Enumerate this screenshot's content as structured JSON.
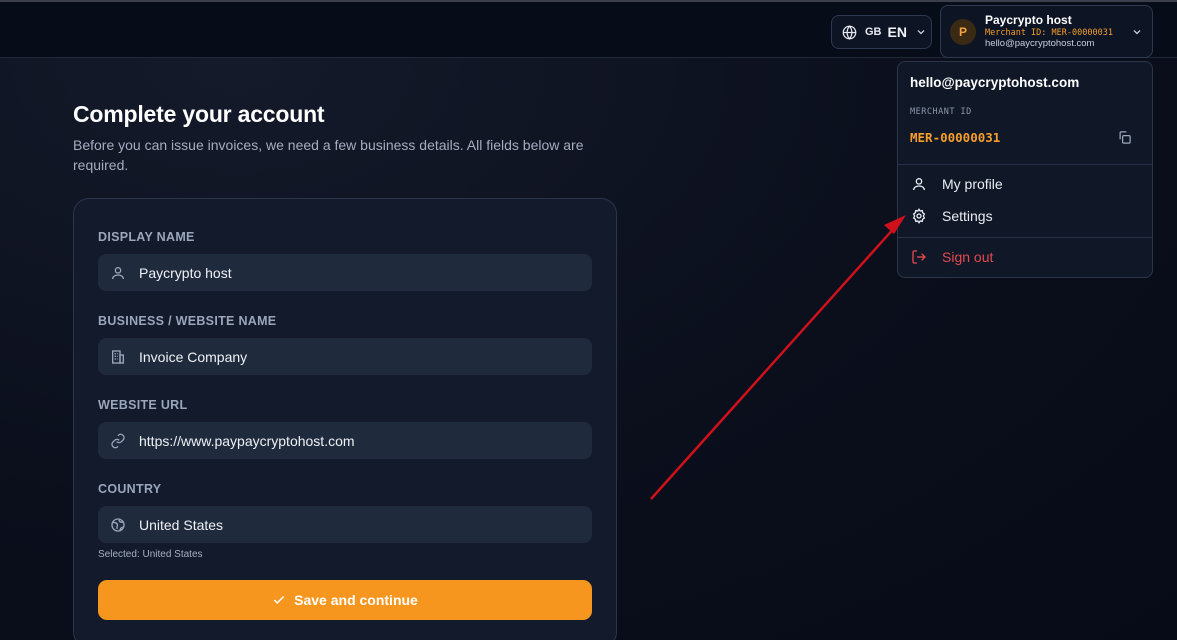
{
  "header": {
    "language": {
      "flag": "GB",
      "code": "EN"
    },
    "account": {
      "avatar_initial": "P",
      "name": "Paycrypto host",
      "merchant_line": "Merchant ID: MER-00000031",
      "email": "hello@paycryptohost.com"
    }
  },
  "main": {
    "title": "Complete your account",
    "subtitle": "Before you can issue invoices, we need a few business details. All fields below are required.",
    "fields": [
      {
        "label": "DISPLAY NAME",
        "value": "Paycrypto host",
        "icon": "user-icon"
      },
      {
        "label": "BUSINESS / WEBSITE NAME",
        "value": "Invoice Company",
        "icon": "building-icon"
      },
      {
        "label": "WEBSITE URL",
        "value": "https://www.paypaycryptohost.com",
        "icon": "link-icon"
      },
      {
        "label": "COUNTRY",
        "value": "United States",
        "icon": "globe-icon"
      }
    ],
    "country_note": "Selected: United States",
    "save_label": "Save and continue"
  },
  "menu": {
    "email": "hello@paycryptohost.com",
    "merchant_id_label": "MERCHANT ID",
    "merchant_id_value": "MER-00000031",
    "items": [
      {
        "label": "My profile",
        "icon": "user-icon"
      },
      {
        "label": "Settings",
        "icon": "gear-icon"
      },
      {
        "label": "Sign out",
        "icon": "sign-out-icon"
      }
    ]
  },
  "colors": {
    "accent": "#f7961e",
    "merchant_id": "#f59e2c",
    "danger": "#e5484d",
    "annotation_arrow": "#d0111b"
  }
}
